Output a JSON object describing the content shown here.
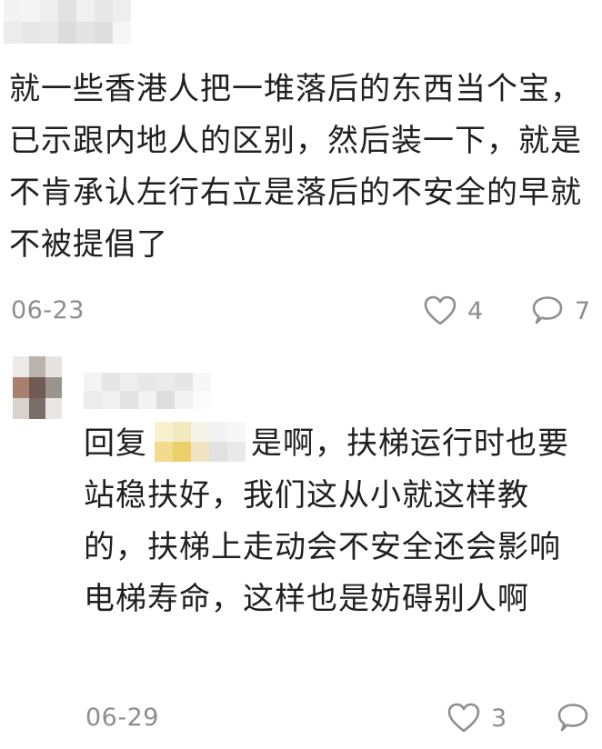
{
  "comments": [
    {
      "text": "就一些香港人把一堆落后的东西当个宝，已示跟内地人的区别，然后装一下，就是不肯承认左行右立是落后的不安全的早就不被提倡了",
      "date": "06-23",
      "likes": "4",
      "replies": "7"
    },
    {
      "reply_prefix": "回复",
      "text": "是啊，扶梯运行时也要站稳扶好，我们这从小就这样教的，扶梯上走动会不安全还会影响电梯寿命，这样也是妨碍别人啊",
      "date": "06-29",
      "likes": "3"
    }
  ],
  "colors": {
    "meta_gray": "#8e8e8e",
    "text": "#202020"
  }
}
